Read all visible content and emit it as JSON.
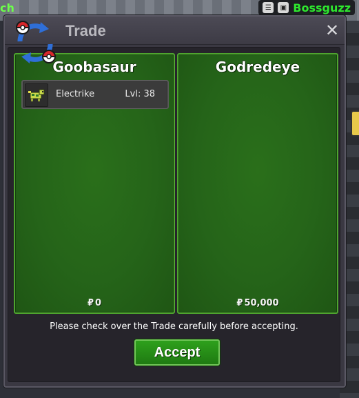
{
  "background": {
    "chat_fragment": "ch",
    "player_name": "Bossguzz"
  },
  "window": {
    "title": "Trade",
    "close_glyph": "✕",
    "logo_icon": "trade-swap-icon"
  },
  "left_panel": {
    "trader_name": "Goobasaur",
    "pokemon": [
      {
        "name": "Electrike",
        "level_label": "Lvl: 38",
        "icon": "electrike-icon"
      }
    ],
    "money_symbol": "₽",
    "money": "0"
  },
  "right_panel": {
    "trader_name": "Godredeye",
    "pokemon": [],
    "money_symbol": "₽",
    "money": "50,000"
  },
  "footer": {
    "notice": "Please check over the Trade carefully before accepting.",
    "accept_label": "Accept"
  },
  "colors": {
    "panel_green": "#256419",
    "panel_border": "#4fa52f",
    "accept_green": "#2ea01c",
    "window_bg": "#3a3842"
  }
}
